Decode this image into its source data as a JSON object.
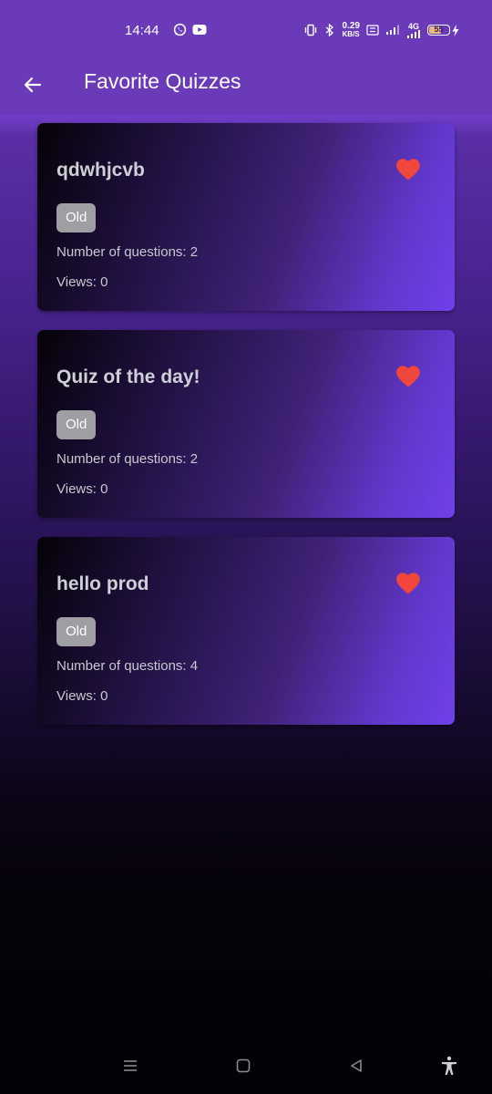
{
  "status_bar": {
    "time": "14:44",
    "icons_left": [
      "whatsapp-icon",
      "youtube-icon"
    ],
    "network_speed": "0.29",
    "network_speed_unit": "KB/S",
    "network_type": "4G",
    "battery_level": "55"
  },
  "app_bar": {
    "title": "Favorite Quizzes"
  },
  "quizzes": [
    {
      "title": "qdwhjcvb",
      "tag": "Old",
      "questions_text": "Number of questions: 2",
      "views_text": "Views: 0",
      "favorite": true
    },
    {
      "title": "Quiz of the day!",
      "tag": "Old",
      "questions_text": "Number of questions: 2",
      "views_text": "Views: 0",
      "favorite": true
    },
    {
      "title": "hello prod",
      "tag": "Old",
      "questions_text": "Number of questions: 4",
      "views_text": "Views: 0",
      "favorite": true
    }
  ],
  "colors": {
    "header": "#6a3ab9",
    "heart": "#f0463c",
    "tag_bg": "#9e9ea3"
  },
  "nav_bar": [
    "recent-apps-icon",
    "home-icon",
    "back-icon",
    "accessibility-icon"
  ]
}
